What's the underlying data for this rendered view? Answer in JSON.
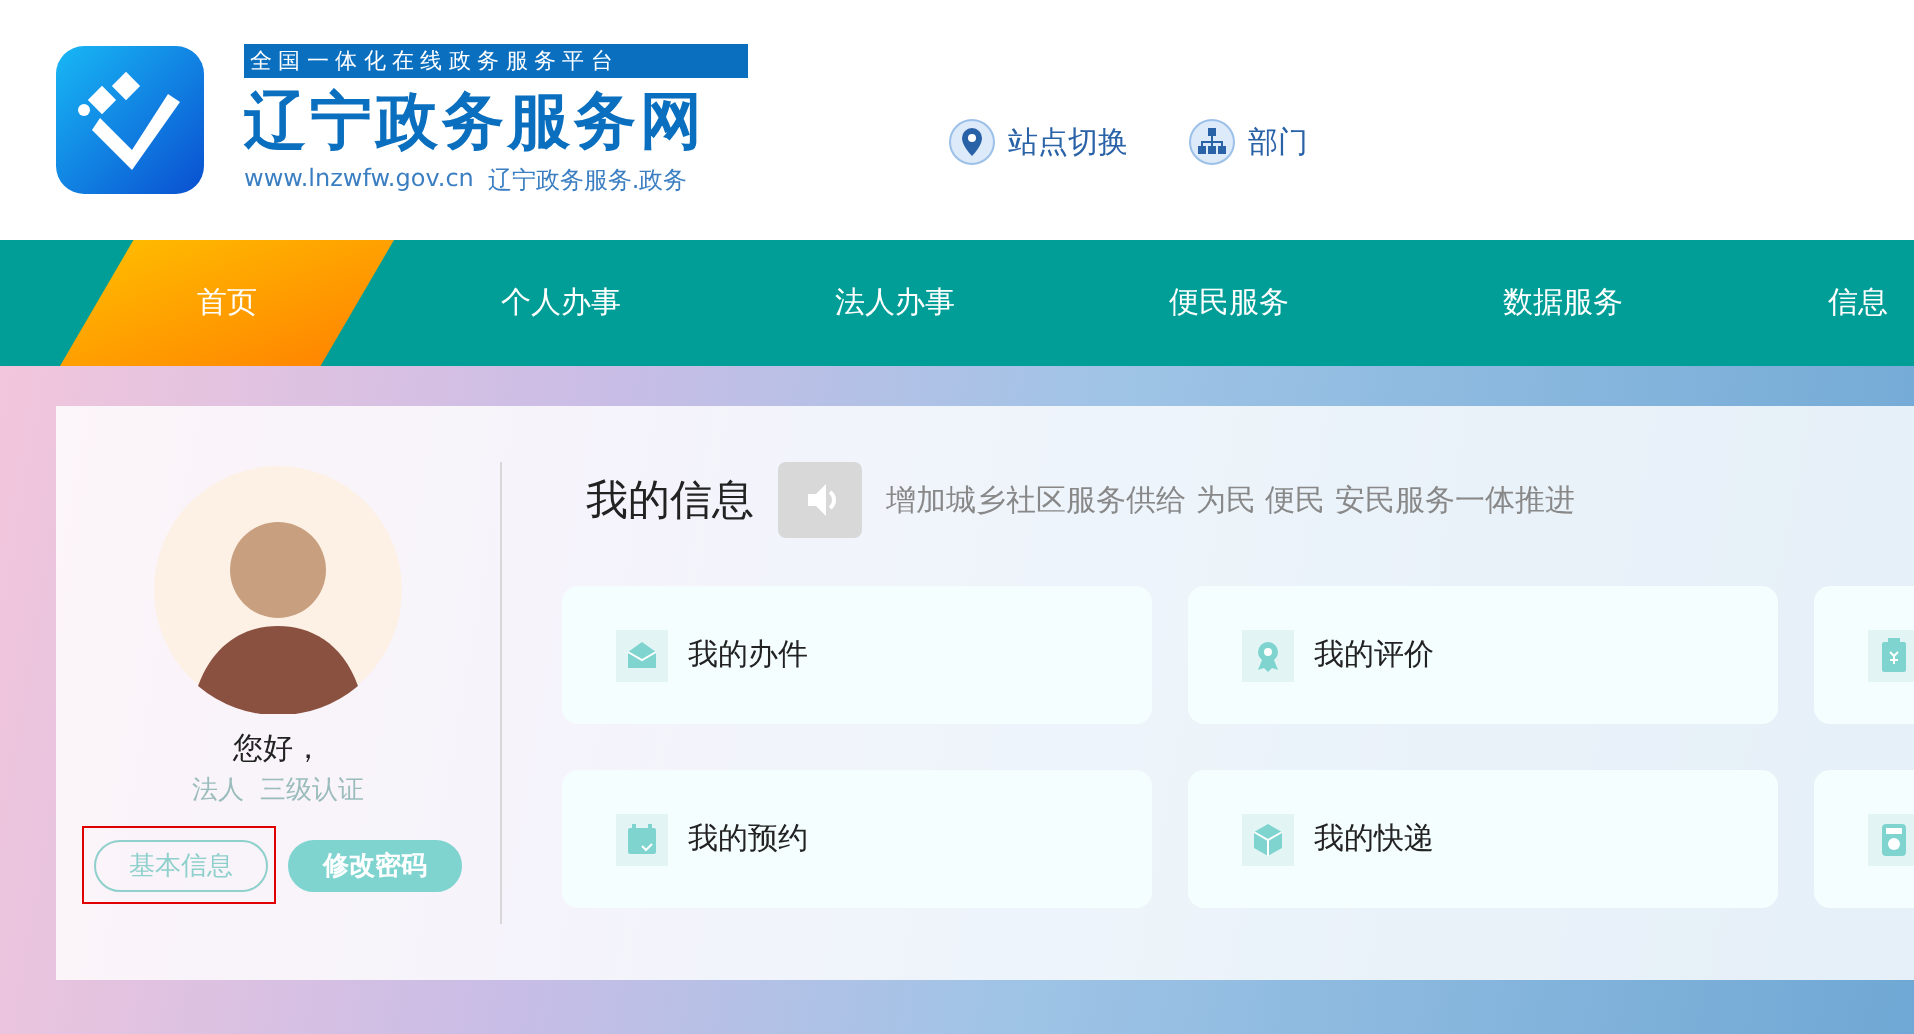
{
  "header": {
    "tagline": "全国一体化在线政务服务平台",
    "site_name": "辽宁政务服务网",
    "url": "www.lnzwfw.gov.cn",
    "domain": "辽宁政务服务.政务",
    "links": [
      {
        "kind": "location",
        "label": "站点切换"
      },
      {
        "kind": "org",
        "label": "部门"
      }
    ]
  },
  "nav": [
    {
      "label": "首页",
      "selected": true
    },
    {
      "label": "个人办事",
      "selected": false
    },
    {
      "label": "法人办事",
      "selected": false
    },
    {
      "label": "便民服务",
      "selected": false
    },
    {
      "label": "数据服务",
      "selected": false
    },
    {
      "label": "信息",
      "selected": false
    }
  ],
  "profile": {
    "greeting": "您好，",
    "role": "法人  三级认证",
    "buttons": [
      {
        "label": "基本信息",
        "kind": "outline",
        "highlighted": true
      },
      {
        "label": "修改密码",
        "kind": "filled",
        "highlighted": false
      }
    ]
  },
  "info": {
    "title": "我的信息",
    "notice": "增加城乡社区服务供给 为民 便民 安民服务一体推进"
  },
  "cards": [
    {
      "kind": "envelope",
      "label": "我的办件"
    },
    {
      "kind": "award",
      "label": "我的评价"
    },
    {
      "kind": "receipt"
    },
    {
      "kind": "calendar",
      "label": "我的预约"
    },
    {
      "kind": "package",
      "label": "我的快递"
    },
    {
      "kind": "disk"
    }
  ]
}
